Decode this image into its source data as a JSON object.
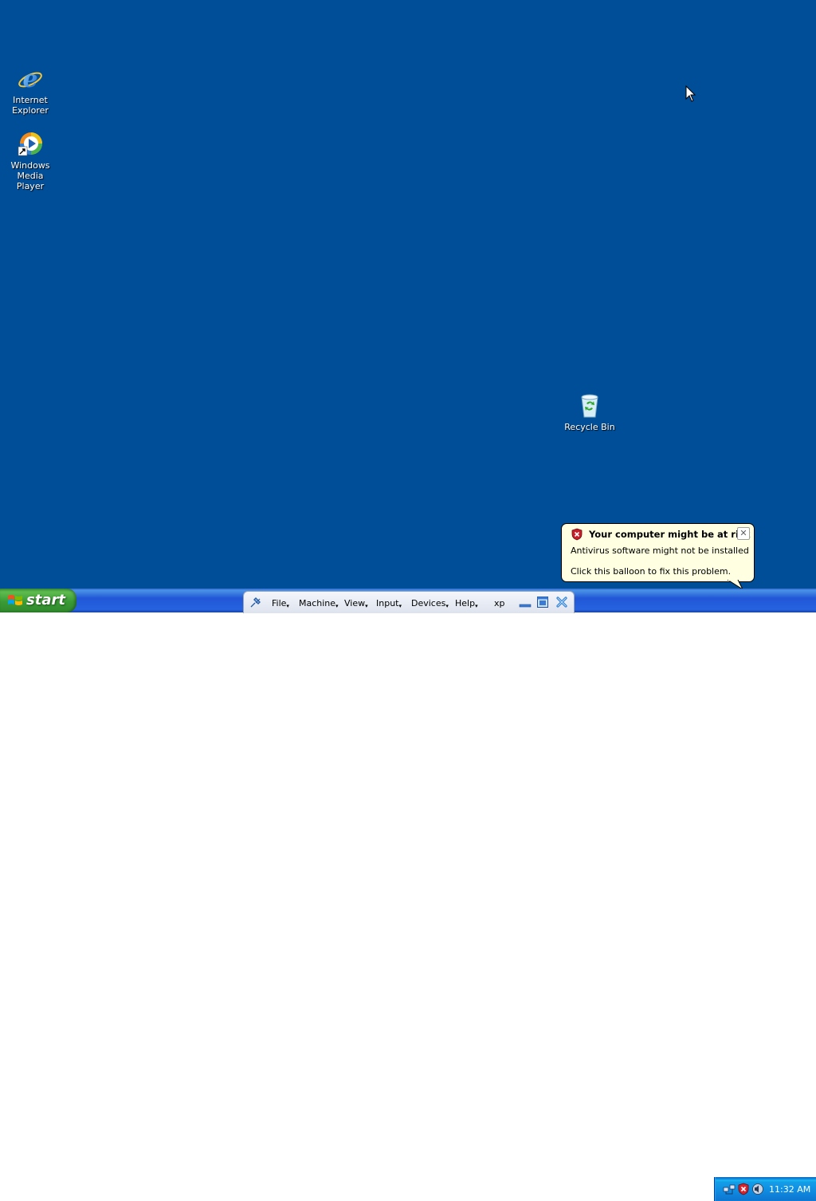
{
  "desktop": {
    "background": "#004e98",
    "icons": [
      {
        "label_line1": "Internet",
        "label_line2": "Explorer",
        "icon": "internet-explorer-icon"
      },
      {
        "label_line1": "Windows Media",
        "label_line2": "Player",
        "icon": "windows-media-player-icon"
      },
      {
        "label_line1": "Recycle Bin",
        "label_line2": "",
        "icon": "recycle-bin-icon"
      }
    ]
  },
  "balloon": {
    "title": "Your computer might be at risk",
    "line1": "Antivirus software might not be installed",
    "line2": "Click this balloon to fix this problem.",
    "close_glyph": "✕",
    "icon": "security-shield-icon"
  },
  "taskbar": {
    "start_label": "start",
    "vbox_menu": [
      {
        "label": "File"
      },
      {
        "label": "Machine"
      },
      {
        "label": "View"
      },
      {
        "label": "Input"
      },
      {
        "label": "Devices"
      },
      {
        "label": "Help"
      }
    ],
    "vm_name": "xp",
    "tray": {
      "clock": "11:32 AM",
      "icons": [
        "network-icon",
        "security-alert-icon",
        "volume-icon"
      ]
    }
  }
}
